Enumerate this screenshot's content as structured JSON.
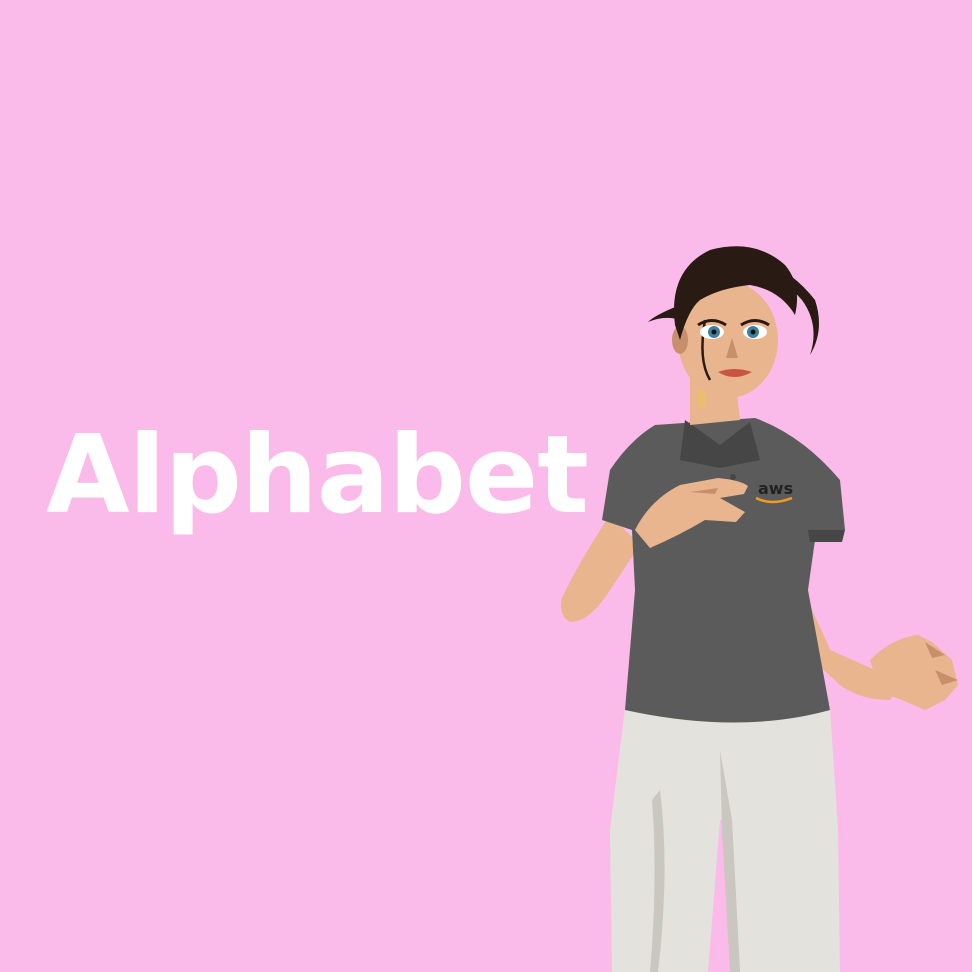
{
  "caption": {
    "word": "Alphabet"
  },
  "avatar": {
    "shirt_logo_text": "aws"
  },
  "colors": {
    "background": "#fbbbea",
    "caption_text": "#ffffff",
    "skin": "#e8b58f",
    "skin_shadow": "#c98f6b",
    "hair": "#2a1a14",
    "shirt": "#5b5b5b",
    "shirt_dark": "#464646",
    "pants": "#e4e2dc",
    "pants_shadow": "#c9c7c0",
    "lips": "#c8553f",
    "eyes": "#3f7fa0",
    "logo_accent": "#f29a1f"
  }
}
